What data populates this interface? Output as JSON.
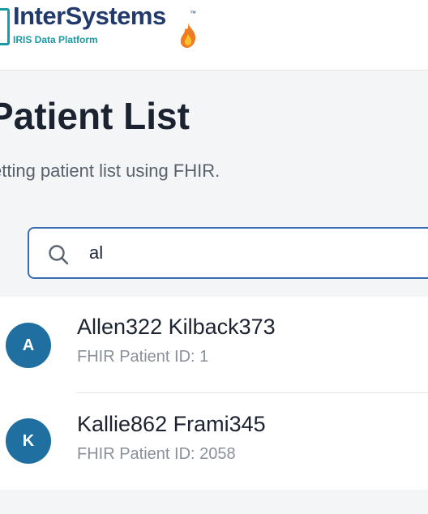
{
  "header": {
    "logo_text": "InterSystems",
    "logo_tm": "™",
    "logo_subtitle": "IRIS Data Platform"
  },
  "page": {
    "title": "Patient List",
    "subtitle": "etting patient list using FHIR."
  },
  "search": {
    "icon": "search-icon",
    "value": "al"
  },
  "patients": [
    {
      "initial": "A",
      "name": "Allen322 Kilback373",
      "id_label": "FHIR Patient ID: 1"
    },
    {
      "initial": "K",
      "name": "Kallie862 Frami345",
      "id_label": "FHIR Patient ID: 2058"
    }
  ],
  "colors": {
    "brand_navy": "#213a6b",
    "brand_teal": "#1a9aa5",
    "avatar": "#1f6fa1",
    "search_border": "#3a6bb0"
  }
}
